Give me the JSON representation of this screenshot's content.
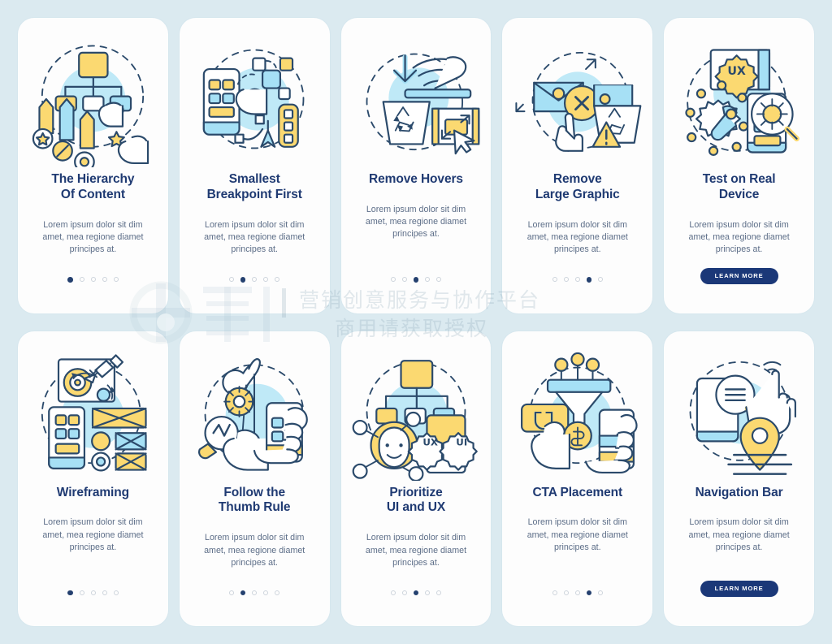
{
  "palette": {
    "page_background": "#dbeaf0",
    "card_background": "#fdfdfd",
    "title_color": "#1f3a72",
    "body_color": "#5d6e88",
    "accent_yellow": "#fbd971",
    "accent_light_blue": "#a6e0f5",
    "accent_blue_fill": "#bfe9f7",
    "stroke_navy": "#2b4a6b",
    "button_navy": "#1b3878",
    "dot_active": "#24406f",
    "dot_inactive": "#cdd4dc"
  },
  "body_text": "Lorem ipsum dolor sit dim\namet, mea regione diamet\nprincipes at.",
  "learn_more_label": "LEARN MORE",
  "watermark": {
    "line1": "营销创意服务与协作平台",
    "line2": "商用请获取授权"
  },
  "cards": [
    {
      "id": "the-hierarchy-of-content",
      "title": "The Hierarchy\nOf Content",
      "body": "Lorem ipsum dolor sit dim\namet, mea regione diamet\nprincipes at.",
      "illustration": "hierarchy-of-content-illustration",
      "footer_type": "dots",
      "dots_total": 5,
      "dots_active_index": 0
    },
    {
      "id": "smallest-breakpoint-first",
      "title": "Smallest\nBreakpoint First",
      "body": "Lorem ipsum dolor sit dim\namet, mea regione diamet\nprincipes at.",
      "illustration": "smallest-breakpoint-first-illustration",
      "footer_type": "dots",
      "dots_total": 5,
      "dots_active_index": 1
    },
    {
      "id": "remove-hovers",
      "title": "Remove Hovers",
      "body": "Lorem ipsum dolor sit dim\namet, mea regione diamet\nprincipes at.",
      "illustration": "remove-hovers-illustration",
      "footer_type": "dots",
      "dots_total": 5,
      "dots_active_index": 2
    },
    {
      "id": "remove-large-graphic",
      "title": "Remove\nLarge Graphic",
      "body": "Lorem ipsum dolor sit dim\namet, mea regione diamet\nprincipes at.",
      "illustration": "remove-large-graphic-illustration",
      "footer_type": "dots",
      "dots_total": 5,
      "dots_active_index": 3
    },
    {
      "id": "test-on-real-device",
      "title": "Test on Real\nDevice",
      "body": "Lorem ipsum dolor sit dim\namet, mea regione diamet\nprincipes at.",
      "illustration": "test-on-real-device-illustration",
      "footer_type": "button",
      "button_label": "LEARN MORE"
    },
    {
      "id": "wireframing",
      "title": "Wireframing",
      "body": "Lorem ipsum dolor sit dim\namet, mea regione diamet\nprincipes at.",
      "illustration": "wireframing-illustration",
      "footer_type": "dots",
      "dots_total": 5,
      "dots_active_index": 0
    },
    {
      "id": "follow-the-thumb-rule",
      "title": "Follow the\nThumb Rule",
      "body": "Lorem ipsum dolor sit dim\namet, mea regione diamet\nprincipes at.",
      "illustration": "follow-the-thumb-rule-illustration",
      "footer_type": "dots",
      "dots_total": 5,
      "dots_active_index": 1
    },
    {
      "id": "prioritize-ui-and-ux",
      "title": "Prioritize\nUI and UX",
      "body": "Lorem ipsum dolor sit dim\namet, mea regione diamet\nprincipes at.",
      "illustration": "prioritize-ui-and-ux-illustration",
      "footer_type": "dots",
      "dots_total": 5,
      "dots_active_index": 2
    },
    {
      "id": "cta-placement",
      "title": "CTA Placement",
      "body": "Lorem ipsum dolor sit dim\namet, mea regione diamet\nprincipes at.",
      "illustration": "cta-placement-illustration",
      "footer_type": "dots",
      "dots_total": 5,
      "dots_active_index": 3
    },
    {
      "id": "navigation-bar",
      "title": "Navigation Bar",
      "body": "Lorem ipsum dolor sit dim\namet, mea regione diamet\nprincipes at.",
      "illustration": "navigation-bar-illustration",
      "footer_type": "button",
      "button_label": "LEARN MORE"
    }
  ]
}
